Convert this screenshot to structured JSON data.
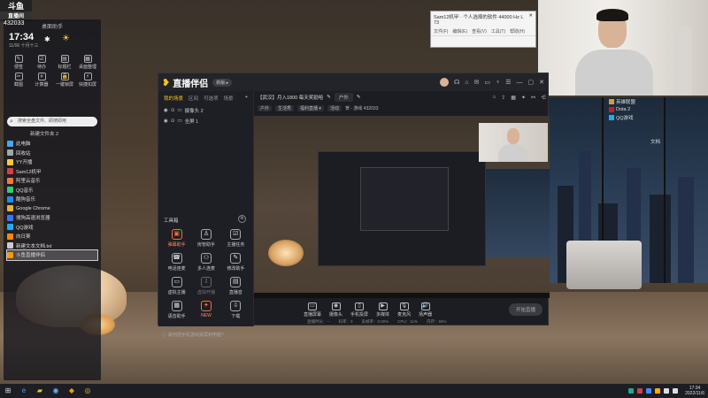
{
  "brand": {
    "line1": "斗鱼",
    "line2": "直播间",
    "room_id": "432033"
  },
  "assistant": {
    "title": "桌面助手",
    "time": "17:34",
    "date": "11/06 十月十三",
    "weather_icon": "☀",
    "tools": [
      {
        "label": "便签",
        "icon": "✎"
      },
      {
        "label": "待办",
        "icon": "☑"
      },
      {
        "label": "标题栏",
        "icon": "▤"
      },
      {
        "label": "桌面整理",
        "icon": "▦"
      },
      {
        "label": "截图",
        "icon": "✂"
      },
      {
        "label": "计算器",
        "icon": "#"
      },
      {
        "label": "一键锁屏",
        "icon": "🔒"
      },
      {
        "label": "快捷扣屏",
        "icon": "⚡"
      }
    ],
    "search_placeholder": "搜索全盘文件、即搜即用",
    "folder": "新建文件夹 2",
    "items": [
      {
        "label": "此电脑",
        "color": "#4aa3ff"
      },
      {
        "label": "回收站",
        "color": "#9aa"
      },
      {
        "label": "YY开播",
        "color": "#ffcc33"
      },
      {
        "label": "Sam12机甲",
        "color": "#cc4444"
      },
      {
        "label": "阿里云音乐",
        "color": "#ff7733"
      },
      {
        "label": "QQ音乐",
        "color": "#33cc77"
      },
      {
        "label": "酷狗音乐",
        "color": "#2288ff"
      },
      {
        "label": "Google Chrome",
        "color": "#e8b52c"
      },
      {
        "label": "搜狗高速浏览器",
        "color": "#3377ff"
      },
      {
        "label": "QQ游戏",
        "color": "#22aaee"
      },
      {
        "label": "向日葵",
        "color": "#ff8800"
      },
      {
        "label": "新建文本文档.txt",
        "color": "#cccccc"
      },
      {
        "label": "斗鱼直播伴侣",
        "color": "#ff9900"
      }
    ],
    "selected_index": 12
  },
  "explorer": {
    "title": "Sam12机甲 · 个人选择的软件  44000 Hz L 73",
    "menu": [
      "文件(F)",
      "编辑(E)",
      "查看(V)",
      "工具(T)",
      "帮助(H)"
    ]
  },
  "right_desktop": {
    "items": [
      {
        "label": "英雄联盟",
        "color": "#c9a23c"
      },
      {
        "label": "Dota 2",
        "color": "#b22"
      },
      {
        "label": "QQ游戏",
        "color": "#2ae"
      }
    ],
    "doc": "文档"
  },
  "app": {
    "name": "直播伴侣",
    "version": "新版 ▸",
    "tabs": [
      "我的场景",
      "区间",
      "可选项",
      "场景"
    ],
    "add_tab": "+",
    "scenes": [
      "摄像头 2",
      "全屏 1"
    ],
    "tools_title": "工具箱",
    "tools": [
      {
        "label": "弹幕助手",
        "icon": "▣",
        "state": "hot"
      },
      {
        "label": "房管助手",
        "icon": "♙",
        "state": "normal"
      },
      {
        "label": "主播任务",
        "icon": "☑",
        "state": "normal"
      },
      {
        "label": "电话连麦",
        "icon": "☎",
        "state": "normal"
      },
      {
        "label": "多人连麦",
        "icon": "⚇",
        "state": "normal"
      },
      {
        "label": "修改助手",
        "icon": "✎",
        "state": "normal"
      },
      {
        "label": "虚拟主播",
        "icon": "▭",
        "state": "normal"
      },
      {
        "label": "虚拟开播",
        "icon": "⇩",
        "state": "dim"
      },
      {
        "label": "直播音",
        "icon": "▤",
        "state": "normal"
      },
      {
        "label": "语音助手",
        "icon": "▦",
        "state": "normal"
      },
      {
        "label": "NEW",
        "icon": "✦",
        "state": "hot"
      },
      {
        "label": "下载",
        "icon": "⇩",
        "state": "normal"
      }
    ],
    "hint": "如何把手机游戏投屏到电脑?",
    "room_title": "【武汉】月入1800 每天奖励哈",
    "room_chip": "户外",
    "category": [
      "户外",
      "生活秀"
    ],
    "rank_chip": "福利直播 ▾",
    "status_chip": "活动",
    "room_no": "贺 - 游戏 432033",
    "bottom": [
      {
        "label": "直播屏幕",
        "icon": "▭"
      },
      {
        "label": "摄像头",
        "icon": "◉"
      },
      {
        "label": "手机投屏",
        "icon": "▯"
      },
      {
        "label": "多媒体",
        "icon": "▶"
      },
      {
        "label": "麦克风",
        "icon": "🎙"
      },
      {
        "label": "扬声器",
        "icon": "🔊"
      }
    ],
    "start_label": "开始直播",
    "status": [
      "直播时长：--",
      "码率：0",
      "丢帧率：0.00%",
      "CPU：11%",
      "内存：55%"
    ]
  },
  "taskbar": {
    "time": "17:34",
    "date": "2022/11/6"
  }
}
